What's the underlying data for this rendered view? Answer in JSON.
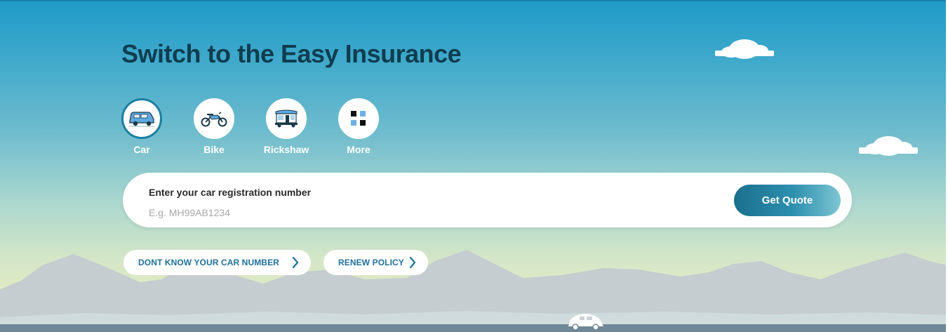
{
  "hero": {
    "title": "Switch to the Easy Insurance"
  },
  "vehicles": [
    {
      "label": "Car",
      "icon": "car-icon",
      "selected": true
    },
    {
      "label": "Bike",
      "icon": "bike-icon",
      "selected": false
    },
    {
      "label": "Rickshaw",
      "icon": "rickshaw-icon",
      "selected": false
    },
    {
      "label": "More",
      "icon": "grid-icon",
      "selected": false
    }
  ],
  "search": {
    "label": "Enter your car registration number",
    "placeholder": "E.g. MH99AB1234",
    "value": "",
    "button_label": "Get Quote"
  },
  "links": {
    "dont_know": "DONT KNOW YOUR CAR NUMBER",
    "renew": "RENEW POLICY"
  },
  "colors": {
    "title": "#0f3d4f",
    "accent": "#1b7fa3",
    "link": "#1d6f9a",
    "mountains": "#c5cdd0",
    "road": "#6f8796"
  }
}
